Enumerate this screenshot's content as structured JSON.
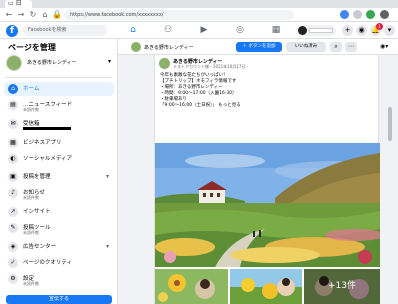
{
  "browser": {
    "url": "https://www.facebook.com/xxxxxxxx/"
  },
  "facebook": {
    "logo": "f",
    "search_placeholder": "Facebookを検索",
    "notification_count": "1"
  },
  "sidebar": {
    "title": "ページを管理",
    "page_name": "あきる野市レンディー",
    "items": [
      {
        "label": "ホーム",
        "icon": "home-icon"
      },
      {
        "label": "…ニュースフィード",
        "sub": "未読件数",
        "icon": "feed-icon"
      },
      {
        "label": "受信箱",
        "icon": "inbox-icon"
      },
      {
        "label": "ビジネスアプリ",
        "icon": "apps-icon"
      },
      {
        "label": "ソーシャルメディア",
        "icon": "social-icon"
      },
      {
        "label": "投稿を管理",
        "icon": "manage-icon"
      },
      {
        "label": "お知らせ",
        "sub": "未読件数",
        "icon": "bell-icon"
      },
      {
        "label": "インサイト",
        "icon": "insights-icon"
      },
      {
        "label": "投稿ツール",
        "sub": "未読件数",
        "icon": "tools-icon"
      },
      {
        "label": "広告センター",
        "icon": "ads-icon"
      },
      {
        "label": "ページのクオリティ",
        "icon": "quality-icon"
      },
      {
        "label": "設定",
        "sub": "未読件数",
        "icon": "settings-icon"
      }
    ],
    "promote_label": "宣伝する"
  },
  "pagebar": {
    "name": "あきる野市レンディー",
    "primary_button": "＋ ボタンを追加",
    "secondary_button": "いいね済み",
    "search_icon": "search-icon",
    "more_icon": "more-icon"
  },
  "post": {
    "author": "あきる野市レンディー",
    "meta": "テストアカウント様・2021年10月17日・",
    "lines": [
      "今年も素敵な花たちがいっぱい！",
      "【プチトリップ】ネモフィラ情報です",
      "・場所：あきる野市レンディー",
      "・時間：9:00〜17:00（入園16:30）",
      "・駐車場あり",
      "「9:00〜16:00（土日祝）」 もっと見る"
    ],
    "more_photos": "+13件"
  }
}
